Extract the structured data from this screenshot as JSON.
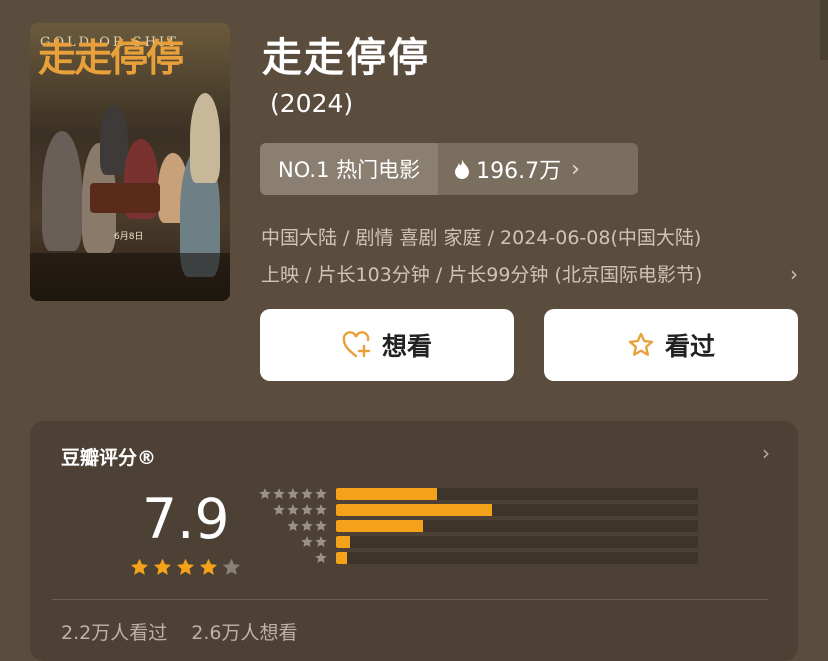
{
  "movie": {
    "title": "走走停停",
    "year": "(2024)",
    "poster": {
      "title": "走走停停",
      "subtitle": "GOLD OR SHIT",
      "date": "6月8日"
    }
  },
  "ranking": {
    "label": "NO.1 热门电影",
    "heat": "196.7万",
    "heat_icon": "flame-icon",
    "chevron": "›"
  },
  "meta": {
    "line1": "中国大陆 / 剧情 喜剧 家庭 / 2024-06-08(中国大陆)",
    "line2": "上映 / 片长103分钟 / 片长99分钟 (北京国际电影节)",
    "chevron": "›"
  },
  "actions": {
    "want_label": "想看",
    "want_icon": "heart-plus-icon",
    "seen_label": "看过",
    "seen_icon": "star-outline-icon"
  },
  "rating": {
    "title": "豆瓣评分®",
    "chevron": "›",
    "score": "7.9",
    "stars": 4,
    "distribution": [
      {
        "stars": 5,
        "fraction": 0.28
      },
      {
        "stars": 4,
        "fraction": 0.43
      },
      {
        "stars": 3,
        "fraction": 0.24
      },
      {
        "stars": 2,
        "fraction": 0.04
      },
      {
        "stars": 1,
        "fraction": 0.03
      }
    ],
    "seen_count": "2.2万人看过",
    "want_count": "2.6万人想看"
  },
  "colors": {
    "background": "#5a4d3e",
    "accent": "#f5a21b",
    "card": "#4c4134",
    "button": "#ffffff"
  }
}
